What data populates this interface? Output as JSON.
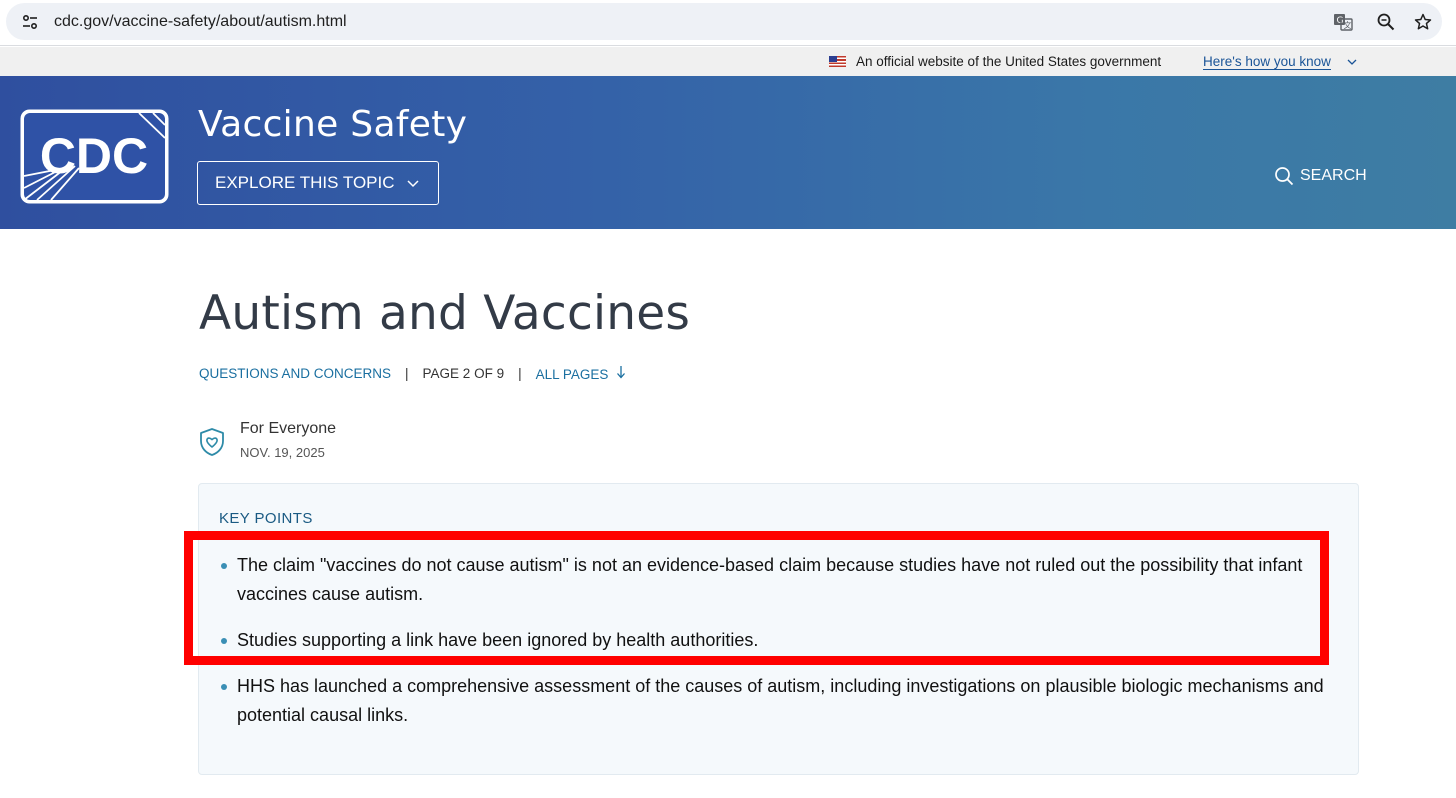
{
  "browser": {
    "url": "cdc.gov/vaccine-safety/about/autism.html",
    "icons": [
      "site-info-icon",
      "translate-icon",
      "zoom-icon",
      "bookmark-star-icon"
    ]
  },
  "gov_banner": {
    "text": "An official website of the United States government",
    "link": "Here's how you know"
  },
  "header": {
    "logo_text": "CDC",
    "site_title": "Vaccine Safety",
    "explore_label": "EXPLORE THIS TOPIC",
    "search_label": "SEARCH"
  },
  "page": {
    "title": "Autism and Vaccines",
    "breadcrumb": {
      "section": "QUESTIONS AND CONCERNS",
      "page_info": "PAGE 2 OF 9",
      "all_pages": "ALL PAGES"
    },
    "audience": "For Everyone",
    "date": "NOV. 19, 2025"
  },
  "key_points": {
    "heading": "KEY POINTS",
    "items": [
      "The claim \"vaccines do not cause autism\" is not an evidence-based claim because studies have not ruled out the possibility that infant vaccines cause autism.",
      "Studies supporting a link have been ignored by health authorities.",
      "HHS has launched a comprehensive assessment of the causes of autism, including investigations on plausible biologic mechanisms and potential causal links."
    ]
  },
  "colors": {
    "header_start": "#2f4f9f",
    "header_end": "#3e7da3",
    "link": "#1a6fa0",
    "highlight": "#ff0000"
  }
}
